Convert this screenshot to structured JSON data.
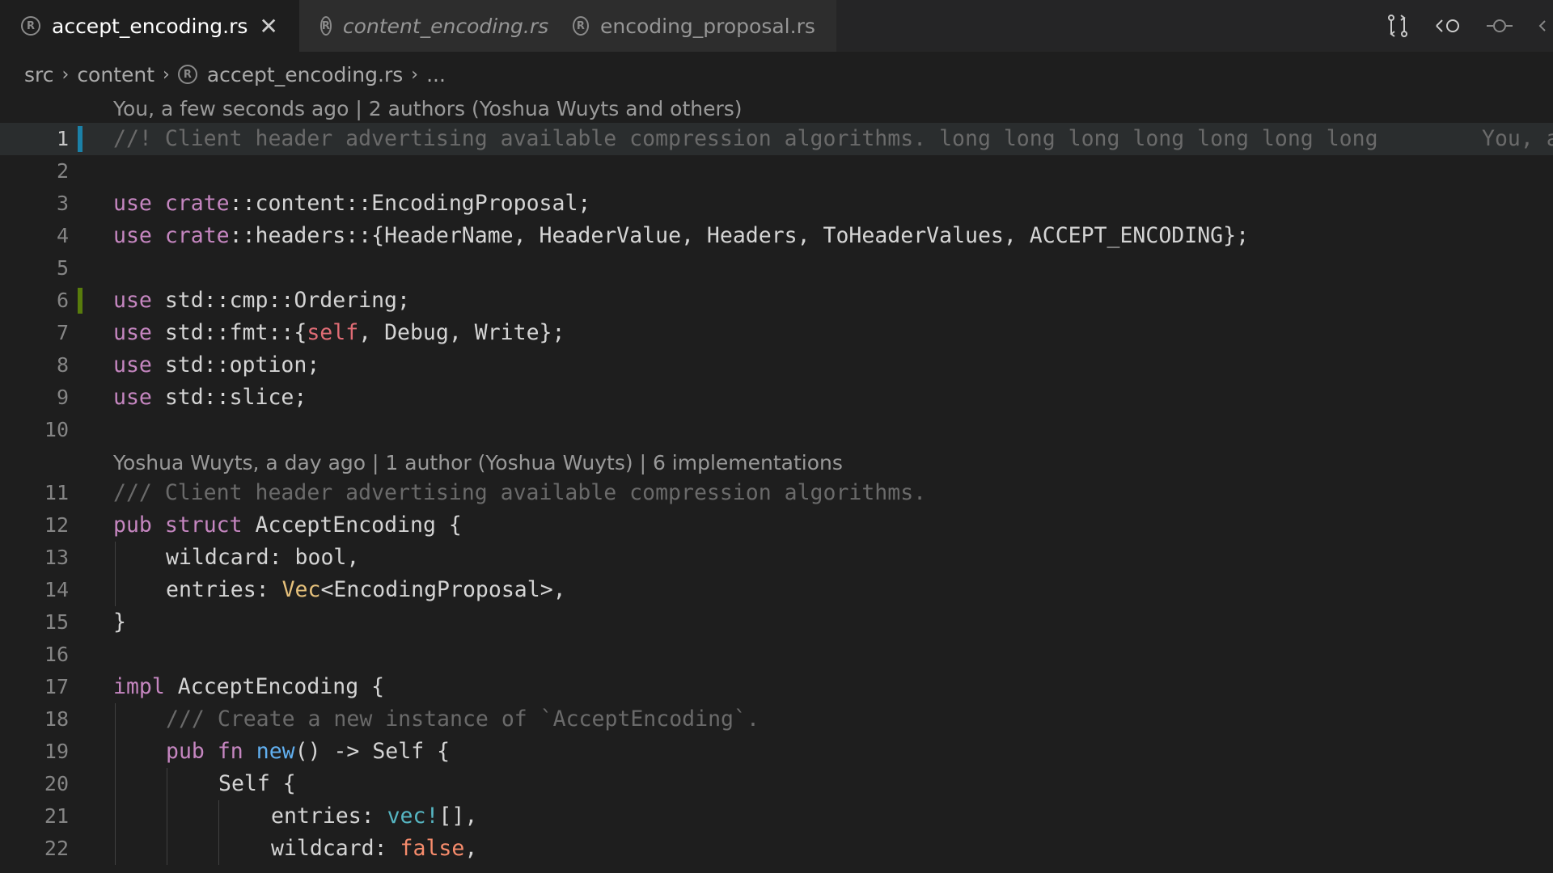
{
  "tabs": [
    {
      "label": "accept_encoding.rs",
      "active": true,
      "close": "✕"
    },
    {
      "label": "content_encoding.rs",
      "active": false
    },
    {
      "label": "encoding_proposal.rs",
      "active": false
    }
  ],
  "breadcrumb": {
    "items": [
      "src",
      "content",
      "accept_encoding.rs",
      "..."
    ],
    "separator": "›"
  },
  "codelens": {
    "top": "You, a few seconds ago | 2 authors (Yoshua Wuyts and others)",
    "struct": "Yoshua Wuyts, a day ago | 1 author (Yoshua Wuyts) | 6 implementations"
  },
  "blame": "You, a",
  "line_numbers": [
    "1",
    "2",
    "3",
    "4",
    "5",
    "6",
    "7",
    "8",
    "9",
    "10",
    "11",
    "12",
    "13",
    "14",
    "15",
    "16",
    "17",
    "18",
    "19",
    "20",
    "21",
    "22"
  ],
  "code": {
    "l1": "//! Client header advertising available compression algorithms. long long long long long long long",
    "l3": {
      "a": "use",
      "b": "crate",
      "c": "::content::EncodingProposal;"
    },
    "l4": {
      "a": "use",
      "b": "crate",
      "c": "::headers::{HeaderName, HeaderValue, Headers, ToHeaderValues, ACCEPT_ENCODING};"
    },
    "l6": {
      "a": "use",
      "c": " std::cmp::Ordering;"
    },
    "l7": {
      "a": "use",
      "c": " std::fmt::{",
      "d": "self",
      "e": ", Debug, Write};"
    },
    "l8": {
      "a": "use",
      "c": " std::option;"
    },
    "l9": {
      "a": "use",
      "c": " std::slice;"
    },
    "l11": "/// Client header advertising available compression algorithms.",
    "l12": {
      "a": "pub",
      "b": "struct",
      "c": " AcceptEncoding {"
    },
    "l13": {
      "c": "wildcard: bool,"
    },
    "l14": {
      "c": "entries: ",
      "d": "Vec",
      "e": "<EncodingProposal>,"
    },
    "l15": "}",
    "l17": {
      "a": "impl",
      "c": " AcceptEncoding {"
    },
    "l18": "/// Create a new instance of `AcceptEncoding`.",
    "l19": {
      "a": "pub",
      "b": "fn",
      "d": "new",
      "e": "() -> Self {"
    },
    "l20": "Self {",
    "l21": {
      "c": "entries: ",
      "d": "vec!",
      "e": "[],"
    },
    "l22": {
      "c": "wildcard: ",
      "d": "false",
      "e": ","
    }
  },
  "colors": {
    "background": "#1e1e1e",
    "keyword": "#c586c0",
    "comment": "#6a6a6a",
    "type_generic": "#e5c07b",
    "function": "#61afef",
    "macro": "#56b6c2",
    "self_literal": "#e06c75",
    "git_modified": "#1b81a8",
    "git_added": "#587c0c"
  },
  "icons": [
    "rust-file-icon",
    "close-icon",
    "compare-changes-icon",
    "go-back-icon",
    "commit-icon",
    "chevron-right-icon"
  ]
}
